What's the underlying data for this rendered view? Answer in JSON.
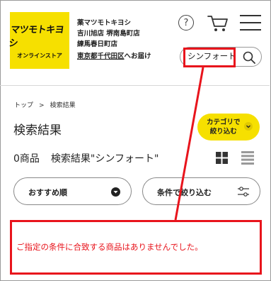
{
  "header": {
    "logo_mark": "マツモトキヨシ",
    "logo_sub": "オンラインストア",
    "store_lines": [
      "薬マツモトキヨシ",
      "吉川旭店 堺南島町店",
      "練馬春日町店"
    ],
    "delivery_area": "東京都千代田区",
    "delivery_suffix": "へお届け",
    "help_label": "?"
  },
  "search": {
    "value": "シンフォート",
    "placeholder": ""
  },
  "breadcrumb": {
    "home": "トップ",
    "separator": ">",
    "current": "検索結果"
  },
  "page": {
    "title": "検索結果",
    "category_button_line1": "カテゴリで",
    "category_button_line2": "絞り込む",
    "result_count": "0商品",
    "result_query": "検索結果\"シンフォート\"",
    "sort_label": "おすすめ順",
    "filter_label": "条件で絞り込む",
    "no_result_message": "ご指定の条件に合致する商品はありませんでした。"
  },
  "colors": {
    "brand_yellow": "#f6e000",
    "annotation_red": "#e8141c"
  }
}
